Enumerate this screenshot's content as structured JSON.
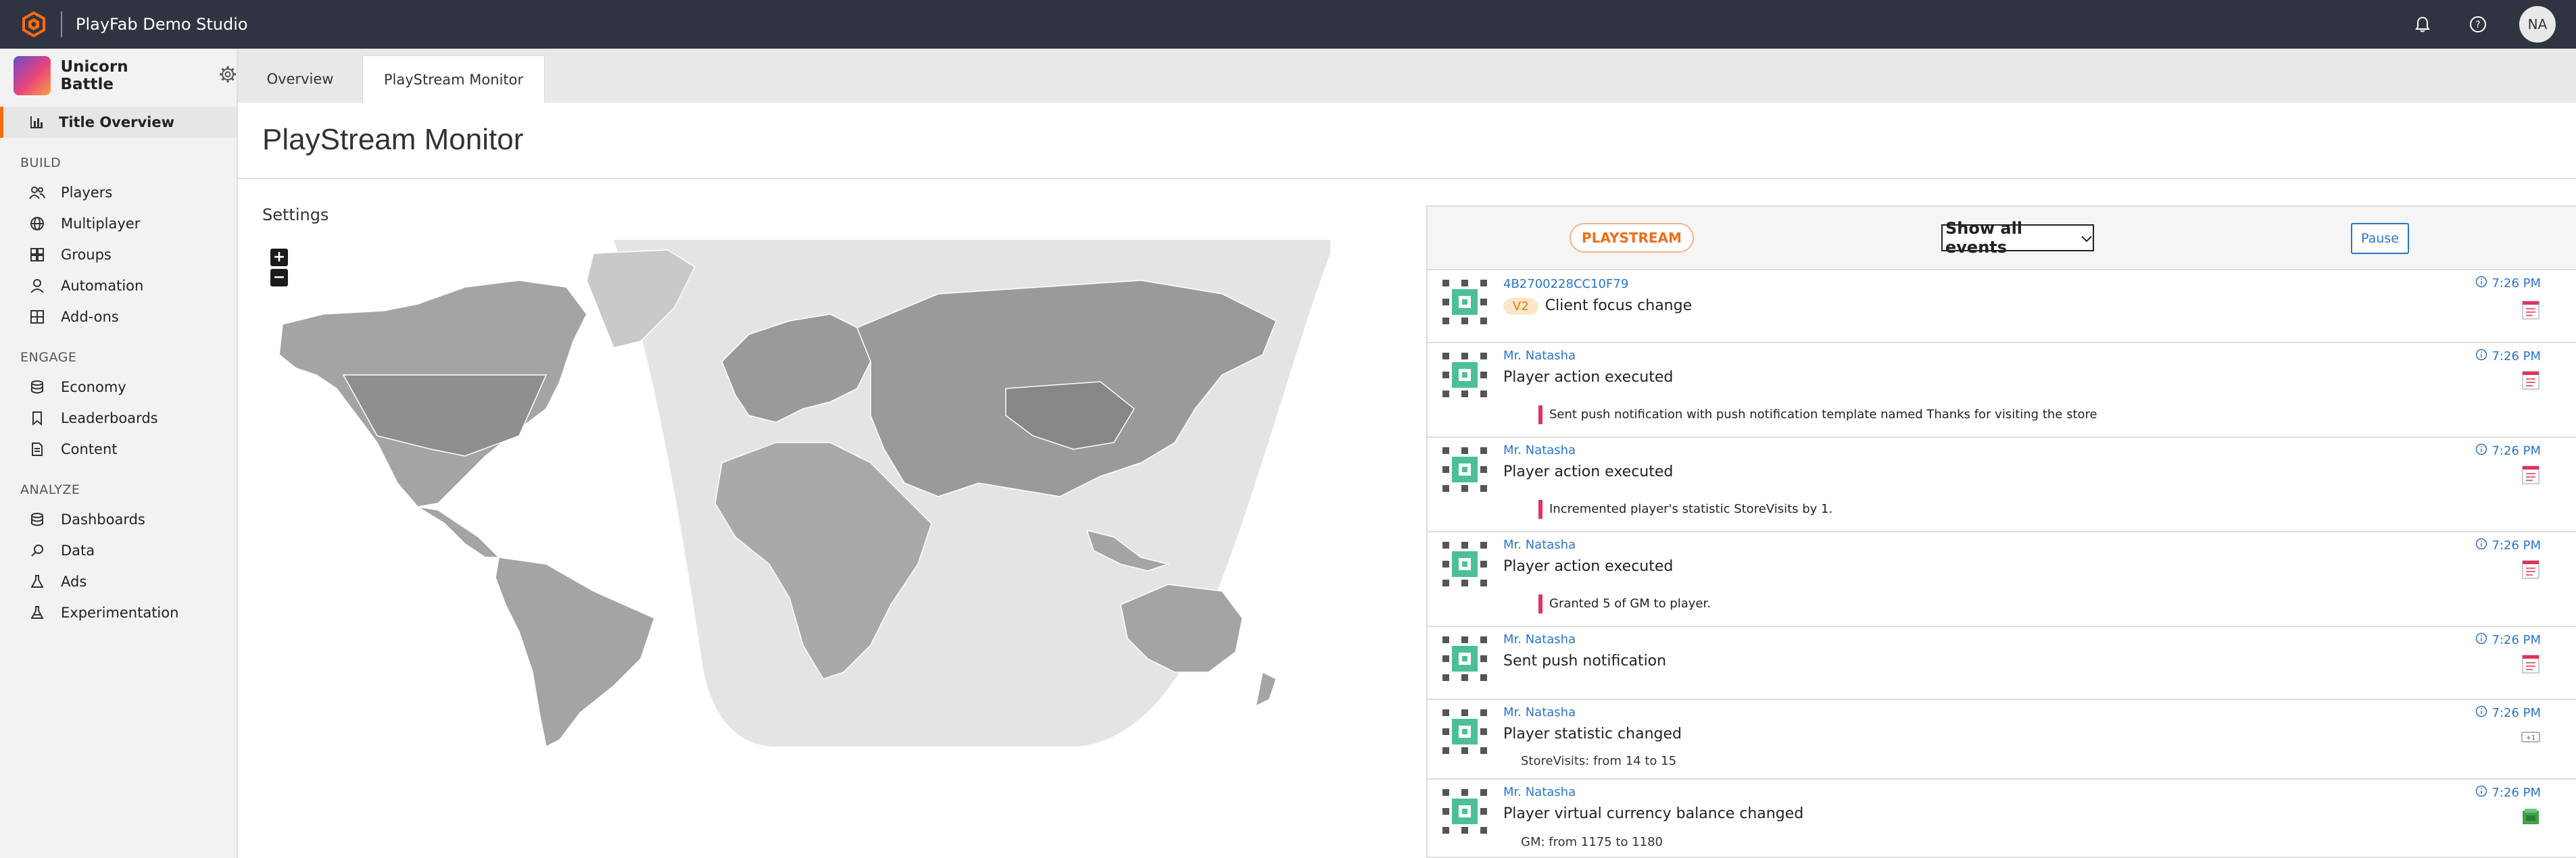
{
  "header": {
    "studio_name": "PlayFab Demo Studio",
    "user_initials": "NA",
    "icons": [
      "playfab-logo-icon",
      "bell-icon",
      "help-icon"
    ]
  },
  "sidebar": {
    "title_name": "Unicorn Battle",
    "active_item": "Title Overview",
    "sections": [
      {
        "label": "BUILD",
        "items": [
          "Players",
          "Multiplayer",
          "Groups",
          "Automation",
          "Add-ons"
        ]
      },
      {
        "label": "ENGAGE",
        "items": [
          "Economy",
          "Leaderboards",
          "Content"
        ]
      },
      {
        "label": "ANALYZE",
        "items": [
          "Dashboards",
          "Data",
          "Ads",
          "Experimentation"
        ]
      }
    ]
  },
  "tabs": [
    "Overview",
    "PlayStream Monitor"
  ],
  "active_tab": "PlayStream Monitor",
  "page": {
    "title": "PlayStream Monitor",
    "settings_label": "Settings"
  },
  "map_controls": {
    "zoom_in": "+",
    "zoom_out": "−"
  },
  "panel": {
    "badge": "PLAYSTREAM",
    "filter_value": "Show all events",
    "pause_label": "Pause"
  },
  "events": [
    {
      "user": "4B2700228CC10F79",
      "badge": "V2",
      "title": "Client focus change",
      "note": "",
      "detail": "",
      "time": "7:26 PM",
      "icon": "event-doc-icon"
    },
    {
      "user": "Mr. Natasha",
      "badge": "",
      "title": "Player action executed",
      "note": "Sent push notification with push notification template named Thanks for visiting the store",
      "detail": "",
      "time": "7:26 PM",
      "icon": "event-doc-icon"
    },
    {
      "user": "Mr. Natasha",
      "badge": "",
      "title": "Player action executed",
      "note": "Incremented player's statistic StoreVisits by 1.",
      "detail": "",
      "time": "7:26 PM",
      "icon": "event-doc-icon"
    },
    {
      "user": "Mr. Natasha",
      "badge": "",
      "title": "Player action executed",
      "note": "Granted 5 of GM to player.",
      "detail": "",
      "time": "7:26 PM",
      "icon": "event-doc-icon"
    },
    {
      "user": "Mr. Natasha",
      "badge": "",
      "title": "Sent push notification",
      "note": "",
      "detail": "",
      "time": "7:26 PM",
      "icon": "event-doc-icon"
    },
    {
      "user": "Mr. Natasha",
      "badge": "",
      "title": "Player statistic changed",
      "note": "",
      "detail": "StoreVisits: from 14 to 15",
      "time": "7:26 PM",
      "icon": "statistic-icon"
    },
    {
      "user": "Mr. Natasha",
      "badge": "",
      "title": "Player virtual currency balance changed",
      "note": "",
      "detail": "GM: from 1175 to 1180",
      "time": "7:26 PM",
      "icon": "currency-icon"
    }
  ],
  "colors": {
    "topbar": "#2f3440",
    "accent_orange": "#f06d1c",
    "link_blue": "#2a74c9",
    "note_bar": "#e0345b",
    "map_land": "#a9a9a9",
    "map_night": "#e4e4e4"
  }
}
